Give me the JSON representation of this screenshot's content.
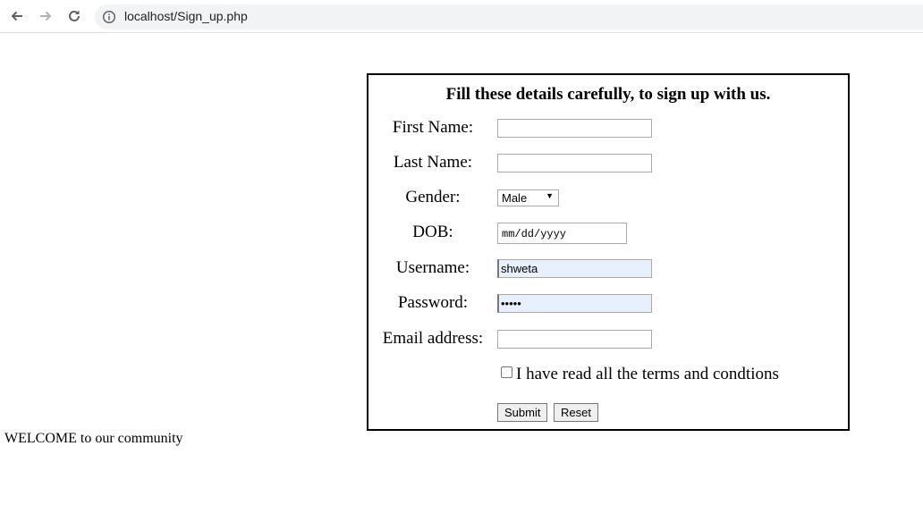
{
  "browser": {
    "url": "localhost/Sign_up.php"
  },
  "form": {
    "heading": "Fill these details carefully, to sign up with us.",
    "fields": {
      "first_name": {
        "label": "First Name:",
        "value": ""
      },
      "last_name": {
        "label": "Last Name:",
        "value": ""
      },
      "gender": {
        "label": "Gender:",
        "selected": "Male"
      },
      "dob": {
        "label": "DOB:",
        "placeholder": "mm/dd/yyyy"
      },
      "username": {
        "label": "Username:",
        "value": "shweta"
      },
      "password": {
        "label": "Password:",
        "value": "•••••"
      },
      "email": {
        "label": "Email address:",
        "value": ""
      }
    },
    "terms_label": "I have read all the terms and condtions",
    "submit_label": "Submit",
    "reset_label": "Reset"
  },
  "welcome_text": "WELCOME to our community",
  "icons": [
    "back-arrow-icon",
    "forward-arrow-icon",
    "reload-icon",
    "info-icon",
    "dropdown-arrow-icon"
  ],
  "colors": {
    "autofill_bg": "#e8f0fe",
    "omnibox_bg": "#f1f3f4"
  }
}
